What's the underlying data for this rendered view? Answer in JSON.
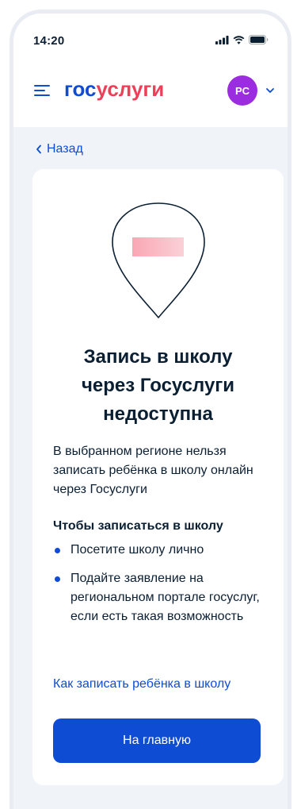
{
  "status_bar": {
    "time": "14:20"
  },
  "header": {
    "logo_part1": "гос",
    "logo_part2": "услуги",
    "avatar_initials": "PC"
  },
  "nav": {
    "back_label": "Назад"
  },
  "card": {
    "title": "Запись в школу через Госуслуги недоступна",
    "description": "В выбранном регионе нельзя записать ребёнка в школу онлайн через Госуслуги",
    "steps_heading": "Чтобы записаться в школу",
    "steps": [
      "Посетите школу лично",
      "Подайте заявление на региональном портале госуслуг, если есть такая возможность"
    ],
    "help_link": "Как записать ребёнка в школу",
    "main_button": "На главную"
  },
  "colors": {
    "primary": "#0d4cd3",
    "logo_accent": "#ee3f58",
    "avatar": "#9b2ce0",
    "background": "#f0f4f9",
    "text": "#0b1f33"
  },
  "icons": {
    "menu": "menu-icon",
    "chevron_down": "chevron-down-icon",
    "chevron_left": "chevron-left-icon",
    "signal": "signal-icon",
    "wifi": "wifi-icon",
    "battery": "battery-icon",
    "illustration": "map-pin-icon"
  }
}
